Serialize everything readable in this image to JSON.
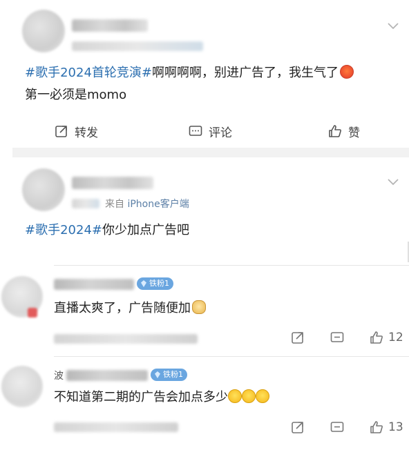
{
  "post1": {
    "topic": "#歌手2024首轮竞演#",
    "text_line1": "啊啊啊啊，别进广告了，我生气了",
    "emoji_1": "angry-face",
    "text_line2": "第一必须是momo"
  },
  "actions": {
    "repost": "转发",
    "comment": "评论",
    "like": "赞"
  },
  "post2": {
    "source_prefix": "来自",
    "source_device": "iPhone客户端",
    "topic": "#歌手2024#",
    "text": "你少加点广告吧"
  },
  "comments": [
    {
      "badge": "铁粉1",
      "text": "直播太爽了，广告随便加",
      "emoji": "doge-face",
      "like_count": "12"
    },
    {
      "name_prefix": "波",
      "badge": "铁粉1",
      "text": "不知道第二期的广告会加点多少",
      "emoji": "laughing-crying-face x3",
      "like_count": "13"
    }
  ],
  "colors": {
    "topic": "#2c6fb0",
    "badge": "#6aa6e0",
    "divider": "#f2f2f2"
  }
}
